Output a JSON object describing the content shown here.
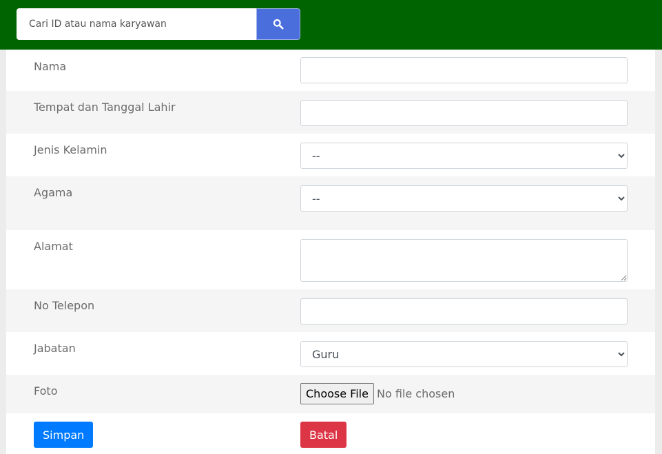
{
  "search": {
    "placeholder": "Cari ID atau nama karyawan",
    "value": "",
    "button_icon": "search-icon"
  },
  "form": {
    "nama": {
      "label": "Nama",
      "value": ""
    },
    "ttl": {
      "label": "Tempat dan Tanggal Lahir",
      "value": ""
    },
    "jenis_kelamin": {
      "label": "Jenis Kelamin",
      "selected": "--"
    },
    "agama": {
      "label": "Agama",
      "selected": "--"
    },
    "alamat": {
      "label": "Alamat",
      "value": ""
    },
    "telepon": {
      "label": "No Telepon",
      "value": ""
    },
    "jabatan": {
      "label": "Jabatan",
      "selected": "Guru"
    },
    "foto": {
      "label": "Foto",
      "button_label": "Choose File",
      "status": "No file chosen"
    }
  },
  "actions": {
    "save_label": "Simpan",
    "cancel_label": "Batal"
  },
  "colors": {
    "header": "#006400",
    "search_button": "#4a6fdc",
    "save_button": "#007bff",
    "cancel_button": "#dc3545"
  }
}
